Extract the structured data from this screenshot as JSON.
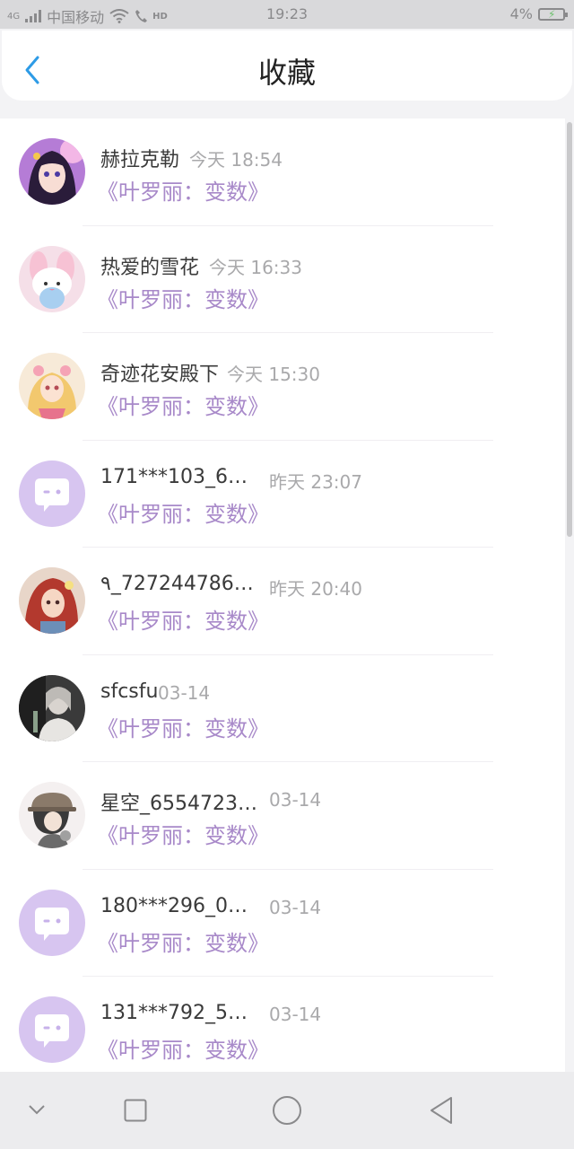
{
  "status_bar": {
    "network": "4G",
    "carrier": "中国移动",
    "hd": "HD",
    "time": "19:23",
    "battery": "4%"
  },
  "header": {
    "title": "收藏",
    "back_icon": "chevron-left-icon"
  },
  "colors": {
    "accent": "#2d9be6",
    "book": "#a889c9",
    "default_avatar_bg": "#d7c5f0"
  },
  "favorites": [
    {
      "name": "赫拉克勒",
      "time": "今天 18:54",
      "book": "《叶罗丽：变数》",
      "avatar": "anime-girl-avatar"
    },
    {
      "name": "热爱的雪花",
      "time": "今天 16:33",
      "book": "《叶罗丽：变数》",
      "avatar": "pink-bunny-avatar"
    },
    {
      "name": "奇迹花安殿下",
      "time": "今天 15:30",
      "book": "《叶罗丽：变数》",
      "avatar": "princess-avatar"
    },
    {
      "name": "171***103_6…",
      "time": "昨天 23:07",
      "book": "《叶罗丽：变数》",
      "avatar": "default-chat-avatar"
    },
    {
      "name": "٩_727244786…",
      "time": "昨天 20:40",
      "book": "《叶罗丽：变数》",
      "avatar": "red-hair-avatar"
    },
    {
      "name": "sfcsfu",
      "time": "03-14",
      "book": "《叶罗丽：变数》",
      "avatar": "photo-avatar"
    },
    {
      "name": "星空_6554723…",
      "time": "03-14",
      "book": "《叶罗丽：变数》",
      "avatar": "hat-boy-avatar"
    },
    {
      "name": "180***296_0…",
      "time": "03-14",
      "book": "《叶罗丽：变数》",
      "avatar": "default-chat-avatar"
    },
    {
      "name": "131***792_5…",
      "time": "03-14",
      "book": "《叶罗丽：变数》",
      "avatar": "default-chat-avatar"
    }
  ],
  "nav_bar": {
    "icons": [
      "collapse-icon",
      "recents-icon",
      "home-icon",
      "back-icon"
    ]
  }
}
